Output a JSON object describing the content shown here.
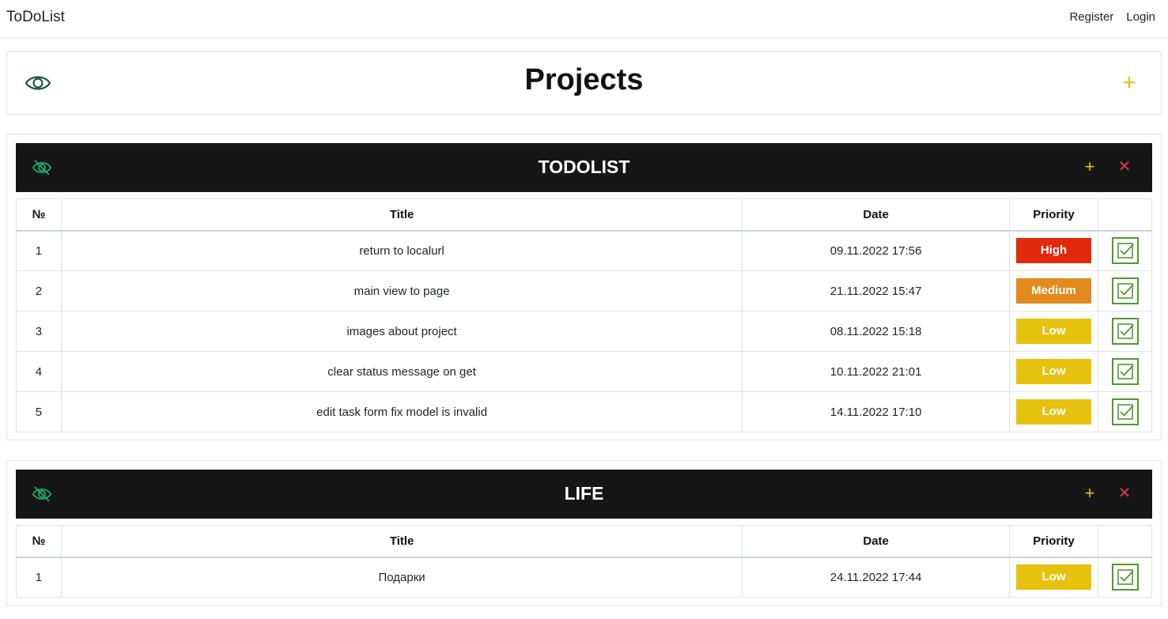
{
  "navbar": {
    "brand": "ToDoList",
    "links": [
      "Register",
      "Login"
    ]
  },
  "header": {
    "title": "Projects",
    "icons": {
      "eye": "eye-icon",
      "add": "plus-icon"
    }
  },
  "table_headers": [
    "№",
    "Title",
    "Date",
    "Priority",
    ""
  ],
  "colors": {
    "High": "#e02a0b",
    "Medium": "#e38a1e",
    "Low": "#e6c20f",
    "accent_yellow": "#e6c200",
    "danger_red": "#dc3545",
    "eye_green": "#1fb072",
    "check_green": "#4f9a2c"
  },
  "projects": [
    {
      "name": "TODOLIST",
      "tasks": [
        {
          "num": "1",
          "title": "return to localurl",
          "date": "09.11.2022 17:56",
          "priority": "High"
        },
        {
          "num": "2",
          "title": "main view to page",
          "date": "21.11.2022 15:47",
          "priority": "Medium"
        },
        {
          "num": "3",
          "title": "images about project",
          "date": "08.11.2022 15:18",
          "priority": "Low"
        },
        {
          "num": "4",
          "title": "clear status message on get",
          "date": "10.11.2022 21:01",
          "priority": "Low"
        },
        {
          "num": "5",
          "title": "edit task form fix model is invalid",
          "date": "14.11.2022 17:10",
          "priority": "Low"
        }
      ]
    },
    {
      "name": "LIFE",
      "tasks": [
        {
          "num": "1",
          "title": "Подарки",
          "date": "24.11.2022 17:44",
          "priority": "Low"
        }
      ]
    }
  ]
}
